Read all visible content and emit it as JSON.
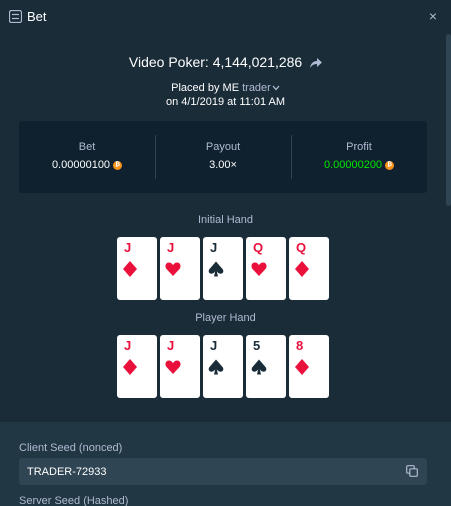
{
  "header": {
    "title": "Bet",
    "close": "×"
  },
  "bet": {
    "game": "Video Poker",
    "bet_id": "4,144,021,286",
    "placed_by_prefix": "Placed by",
    "user_badge": "ME",
    "username": "trader",
    "date": "on 4/1/2019 at 11:01 AM"
  },
  "stats": {
    "bet_label": "Bet",
    "bet_value": "0.00000100",
    "payout_label": "Payout",
    "payout_value": "3.00×",
    "profit_label": "Profit",
    "profit_value": "0.00000200",
    "currency_symbol": "₿",
    "profit_color": "#00e701"
  },
  "initial_hand": {
    "label": "Initial Hand",
    "cards": [
      {
        "rank": "J",
        "suit": "diamond"
      },
      {
        "rank": "J",
        "suit": "heart"
      },
      {
        "rank": "J",
        "suit": "spade"
      },
      {
        "rank": "Q",
        "suit": "heart"
      },
      {
        "rank": "Q",
        "suit": "diamond"
      }
    ]
  },
  "player_hand": {
    "label": "Player Hand",
    "cards": [
      {
        "rank": "J",
        "suit": "diamond"
      },
      {
        "rank": "J",
        "suit": "heart"
      },
      {
        "rank": "J",
        "suit": "spade"
      },
      {
        "rank": "5",
        "suit": "spade"
      },
      {
        "rank": "8",
        "suit": "diamond"
      }
    ]
  },
  "seeds": {
    "client_label": "Client Seed (nonced)",
    "client_value": "TRADER-72933",
    "server_label": "Server Seed (Hashed)"
  },
  "colors": {
    "red_suit": "#e9113c",
    "black_suit": "#1a2c38"
  }
}
